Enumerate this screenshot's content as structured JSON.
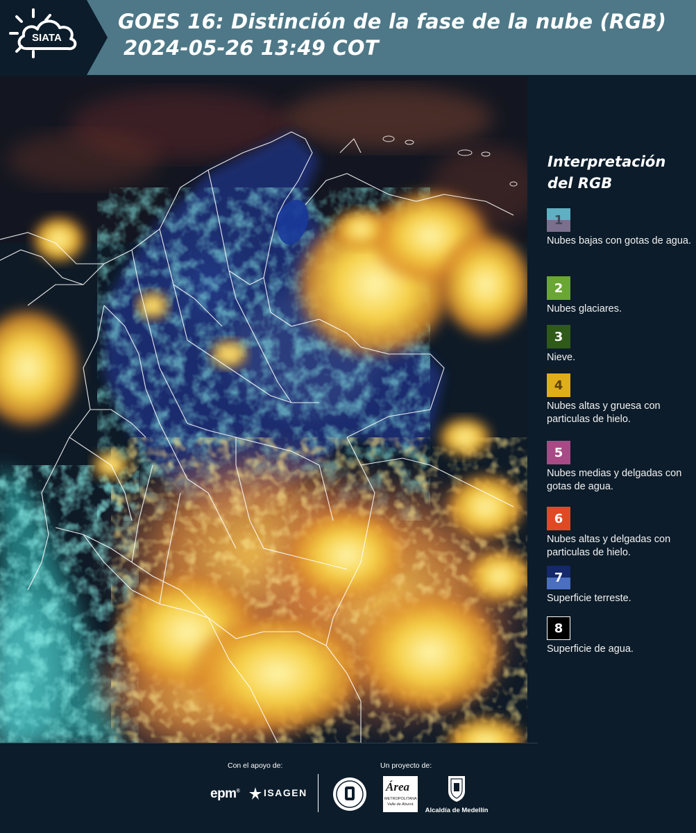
{
  "header": {
    "logo_text": "SIATA",
    "title_line1": "GOES 16: Distinción de la fase de la nube (RGB)",
    "title_line2": "2024-05-26 13:49 COT"
  },
  "legend": {
    "title_line1": "Interpretación",
    "title_line2": "del RGB",
    "items": [
      {
        "number": "1",
        "label": "Nubes bajas con gotas de agua.",
        "color_top": "#5fb0c2",
        "color_bottom": "#7a6f8c",
        "num_color": "#3e4a5a"
      },
      {
        "number": "2",
        "label": "Nubes glaciares.",
        "color_top": "#6aa632",
        "color_bottom": "#6aa632",
        "num_color": "#ffffff"
      },
      {
        "number": "3",
        "label": "Nieve.",
        "color_top": "#2f5a1a",
        "color_bottom": "#2f5a1a",
        "num_color": "#ffffff"
      },
      {
        "number": "4",
        "label": "Nubes altas y gruesa con particulas de hielo.",
        "color_top": "#e0ae1a",
        "color_bottom": "#e0ae1a",
        "num_color": "#5a4200"
      },
      {
        "number": "5",
        "label": "Nubes medias y delgadas con gotas de agua.",
        "color_top": "#a84a86",
        "color_bottom": "#a84a86",
        "num_color": "#ffffff"
      },
      {
        "number": "6",
        "label": "Nubes altas y delgadas con particulas de hielo.",
        "color_top": "#e04a22",
        "color_bottom": "#e04a22",
        "num_color": "#ffffff"
      },
      {
        "number": "7",
        "label": "Superficie terreste.",
        "color_top": "#14286a",
        "color_bottom": "#4a6ec0",
        "num_color": "#ffffff"
      },
      {
        "number": "8",
        "label": "Superficie de agua.",
        "color_top": "#000000",
        "color_bottom": "#000000",
        "num_color": "#ffffff"
      }
    ]
  },
  "footer": {
    "support_label": "Con el apoyo de:",
    "project_label": "Un proyecto de:",
    "sponsor_1": "epm",
    "sponsor_2": "ISAGEN",
    "partner_area": "Área",
    "partner_area_sub1": "METROPOLITANA",
    "partner_area_sub2": "Valle de Aburrá",
    "partner_alcaldia": "Alcaldía de Medellín"
  },
  "colors": {
    "header_bg": "#4e7887",
    "page_bg": "#0c1c2a",
    "cloud_yellow": "#f5d24a",
    "cloud_orange": "#e08a2a",
    "land_blue": "#1a2e6a",
    "cyan": "#3fc8c0",
    "border_white": "#ffffff"
  }
}
